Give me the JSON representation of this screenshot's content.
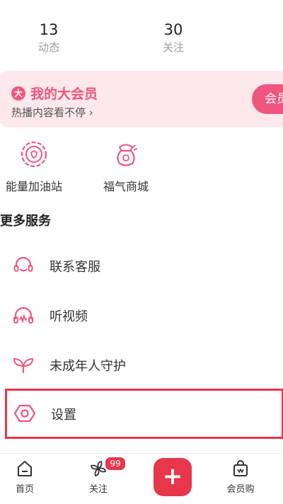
{
  "stats": [
    {
      "value": "13",
      "label": "动态"
    },
    {
      "value": "30",
      "label": "关注"
    }
  ],
  "vip": {
    "badge": "大",
    "title": "我的大会员",
    "subtitle": "热播内容看不停 ›",
    "button": "会员"
  },
  "quick_links": [
    {
      "label": "能量加油站",
      "icon": "energy-station-icon"
    },
    {
      "label": "福气商城",
      "icon": "lucky-mall-icon"
    }
  ],
  "more_services": {
    "title": "更多服务",
    "items": [
      {
        "label": "联系客服",
        "icon": "headset-icon"
      },
      {
        "label": "听视频",
        "icon": "headphones-icon"
      },
      {
        "label": "未成年人守护",
        "icon": "sprout-icon"
      },
      {
        "label": "设置",
        "icon": "hexagon-settings-icon"
      }
    ]
  },
  "tabbar": {
    "items": [
      {
        "label": "首页",
        "icon": "home-icon"
      },
      {
        "label": "关注",
        "icon": "pinwheel-icon",
        "badge": "99"
      },
      {
        "label": "",
        "icon": "plus-icon"
      },
      {
        "label": "会员购",
        "icon": "shopping-bag-icon"
      }
    ]
  },
  "colors": {
    "accent": "#f0557d",
    "highlight": "#e8364a",
    "vip_bg": "#fde8ec"
  }
}
